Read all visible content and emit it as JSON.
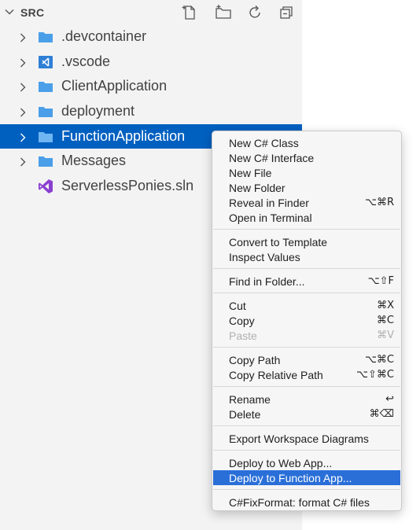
{
  "explorer": {
    "title": "SRC",
    "actions": [
      {
        "name": "new-file-icon"
      },
      {
        "name": "new-folder-icon"
      },
      {
        "name": "refresh-icon"
      },
      {
        "name": "collapse-all-icon"
      }
    ],
    "items": [
      {
        "label": ".devcontainer",
        "kind": "folder",
        "icon": "folder-icon"
      },
      {
        "label": ".vscode",
        "kind": "folder",
        "icon": "vscode-folder-icon"
      },
      {
        "label": "ClientApplication",
        "kind": "folder",
        "icon": "folder-icon"
      },
      {
        "label": "deployment",
        "kind": "folder",
        "icon": "folder-icon"
      },
      {
        "label": "FunctionApplication",
        "kind": "folder",
        "icon": "folder-icon",
        "selected": true
      },
      {
        "label": "Messages",
        "kind": "folder",
        "icon": "folder-icon"
      },
      {
        "label": "ServerlessPonies.sln",
        "kind": "file",
        "icon": "visual-studio-solution-icon"
      }
    ]
  },
  "context_menu": {
    "groups": [
      [
        {
          "label": "New C# Class",
          "shortcut": ""
        },
        {
          "label": "New C# Interface",
          "shortcut": ""
        },
        {
          "label": "New File",
          "shortcut": ""
        },
        {
          "label": "New Folder",
          "shortcut": ""
        },
        {
          "label": "Reveal in Finder",
          "shortcut": "⌥⌘R"
        },
        {
          "label": "Open in Terminal",
          "shortcut": ""
        }
      ],
      [
        {
          "label": "Convert to Template",
          "shortcut": ""
        },
        {
          "label": "Inspect Values",
          "shortcut": ""
        }
      ],
      [
        {
          "label": "Find in Folder...",
          "shortcut": "⌥⇧F"
        }
      ],
      [
        {
          "label": "Cut",
          "shortcut": "⌘X"
        },
        {
          "label": "Copy",
          "shortcut": "⌘C"
        },
        {
          "label": "Paste",
          "shortcut": "⌘V",
          "disabled": true
        }
      ],
      [
        {
          "label": "Copy Path",
          "shortcut": "⌥⌘C"
        },
        {
          "label": "Copy Relative Path",
          "shortcut": "⌥⇧⌘C"
        }
      ],
      [
        {
          "label": "Rename",
          "shortcut": "↩"
        },
        {
          "label": "Delete",
          "shortcut": "⌘⌫"
        }
      ],
      [
        {
          "label": "Export Workspace Diagrams",
          "shortcut": ""
        }
      ],
      [
        {
          "label": "Deploy to Web App...",
          "shortcut": ""
        },
        {
          "label": "Deploy to Function App...",
          "shortcut": "",
          "highlighted": true
        }
      ],
      [
        {
          "label": "C#FixFormat: format C# files",
          "shortcut": ""
        }
      ]
    ]
  },
  "colors": {
    "selection": "#0060c0",
    "menu_highlight": "#2a6fd8",
    "folder_blue": "#4a9fe8",
    "vs_purple": "#8a3fd1"
  }
}
